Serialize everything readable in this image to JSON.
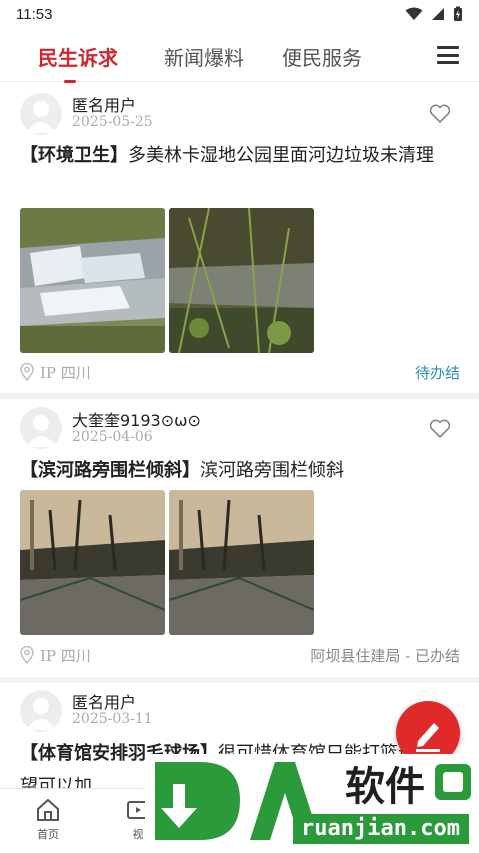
{
  "status_bar": {
    "time": "11:53"
  },
  "tabs": [
    {
      "label": "民生诉求",
      "active": true
    },
    {
      "label": "新闻爆料",
      "active": false
    },
    {
      "label": "便民服务",
      "active": false
    }
  ],
  "posts": [
    {
      "username": "匿名用户",
      "date": "2025-05-25",
      "tag": "【环境卫生】",
      "text": "多美林卡湿地公园里面河边垃圾未清理",
      "ip": "IP 四川",
      "status": "待办结"
    },
    {
      "username": "大奎奎9193⊙ω⊙",
      "date": "2025-04-06",
      "tag": "【滨河路旁围栏倾斜】",
      "text": "滨河路旁围栏倾斜",
      "ip": "IP 四川",
      "status": "阿坝县住建局 - 已办结"
    },
    {
      "username": "匿名用户",
      "date": "2025-03-11",
      "tag": "【体育馆安排羽毛球场】",
      "text": "很可惜体育馆只能打篮球，希望可以加",
      "ip": "",
      "status": ""
    }
  ],
  "bottom_nav": [
    {
      "label": "首页",
      "icon": "home-icon"
    },
    {
      "label": "视",
      "icon": "video-icon"
    }
  ],
  "watermark": {
    "brand": "软件",
    "url": "ruanjian.com"
  },
  "colors": {
    "accent": "#d0262d",
    "pending": "#2a8fb5",
    "fab": "#e02a2a"
  }
}
